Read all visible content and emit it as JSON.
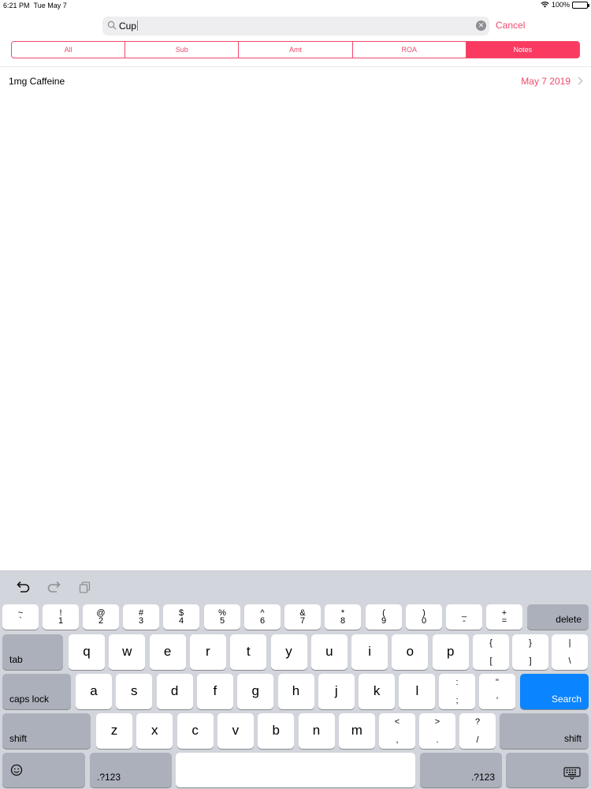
{
  "status_bar": {
    "time": "6:21 PM",
    "date": "Tue May 7",
    "battery": "100%"
  },
  "search": {
    "value": "Cup",
    "cancel_label": "Cancel"
  },
  "segments": [
    {
      "label": "All",
      "selected": false
    },
    {
      "label": "Sub",
      "selected": false
    },
    {
      "label": "Amt",
      "selected": false
    },
    {
      "label": "ROA",
      "selected": false
    },
    {
      "label": "Notes",
      "selected": true
    }
  ],
  "results": [
    {
      "title": "1mg Caffeine",
      "date": "May 7 2019"
    }
  ],
  "keyboard": {
    "row_numbers": [
      {
        "top": "~",
        "bot": "`"
      },
      {
        "top": "!",
        "bot": "1"
      },
      {
        "top": "@",
        "bot": "2"
      },
      {
        "top": "#",
        "bot": "3"
      },
      {
        "top": "$",
        "bot": "4"
      },
      {
        "top": "%",
        "bot": "5"
      },
      {
        "top": "^",
        "bot": "6"
      },
      {
        "top": "&",
        "bot": "7"
      },
      {
        "top": "*",
        "bot": "8"
      },
      {
        "top": "(",
        "bot": "9"
      },
      {
        "top": ")",
        "bot": "0"
      },
      {
        "top": "_",
        "bot": "-"
      },
      {
        "top": "+",
        "bot": "="
      }
    ],
    "delete_label": "delete",
    "tab_label": "tab",
    "row_q": [
      "q",
      "w",
      "e",
      "r",
      "t",
      "y",
      "u",
      "i",
      "o",
      "p"
    ],
    "row_q_symbols": [
      {
        "top": "{",
        "bot": "["
      },
      {
        "top": "}",
        "bot": "]"
      },
      {
        "top": "|",
        "bot": "\\"
      }
    ],
    "caps_label": "caps lock",
    "row_a": [
      "a",
      "s",
      "d",
      "f",
      "g",
      "h",
      "j",
      "k",
      "l"
    ],
    "row_a_symbols": [
      {
        "top": ":",
        "bot": ";"
      },
      {
        "top": "\"",
        "bot": "'"
      }
    ],
    "search_label": "Search",
    "shift_label": "shift",
    "row_z": [
      "z",
      "x",
      "c",
      "v",
      "b",
      "n",
      "m"
    ],
    "row_z_symbols": [
      {
        "top": "<",
        "bot": ","
      },
      {
        "top": ">",
        "bot": "."
      },
      {
        "top": "?",
        "bot": "/"
      }
    ],
    "numbers_label": ".?123"
  }
}
